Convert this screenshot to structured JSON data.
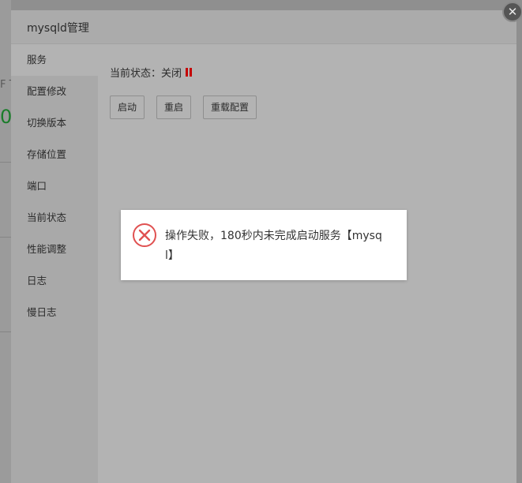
{
  "background": {
    "partial_text_1": "F T",
    "partial_text_2": "0"
  },
  "dialog": {
    "title": "mysqld管理",
    "close_icon": "close-icon"
  },
  "sidebar": {
    "items": [
      {
        "label": "服务",
        "active": true
      },
      {
        "label": "配置修改"
      },
      {
        "label": "切换版本"
      },
      {
        "label": "存储位置"
      },
      {
        "label": "端口"
      },
      {
        "label": "当前状态"
      },
      {
        "label": "性能调整"
      },
      {
        "label": "日志"
      },
      {
        "label": "慢日志"
      }
    ]
  },
  "service": {
    "status_label": "当前状态：",
    "status_value": "关闭",
    "status_icon": "pause-icon",
    "status_color": "#c40000",
    "buttons": {
      "start": "启动",
      "restart": "重启",
      "reload": "重载配置"
    }
  },
  "toast": {
    "icon": "error-icon",
    "icon_color": "#e05151",
    "message": "操作失败，180秒内未完成启动服务【mysql】"
  }
}
